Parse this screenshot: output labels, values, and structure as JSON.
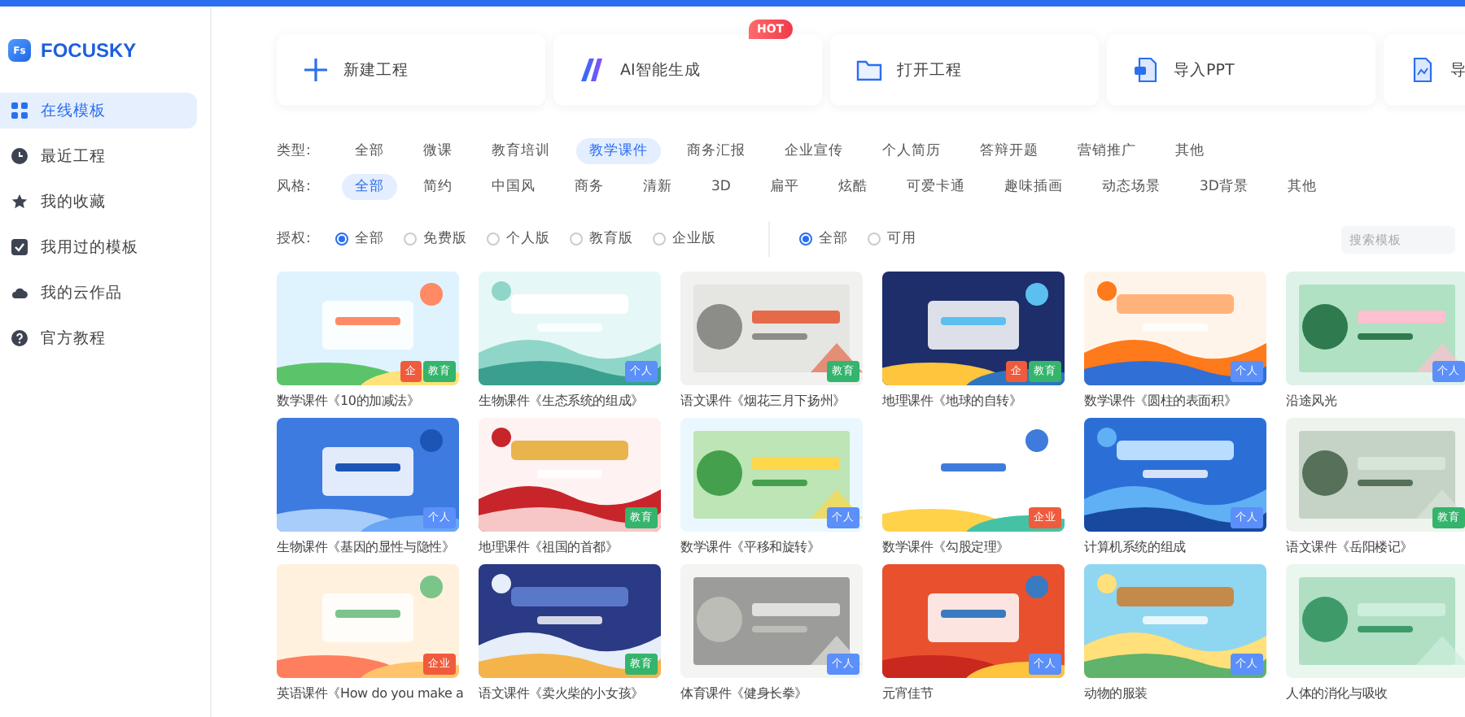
{
  "logo": {
    "badge": "Fs",
    "name": "FOCUSKY"
  },
  "sidebar": {
    "items": [
      {
        "label": "在线模板",
        "selected": true
      },
      {
        "label": "最近工程",
        "selected": false
      },
      {
        "label": "我的收藏",
        "selected": false
      },
      {
        "label": "我用过的模板",
        "selected": false
      },
      {
        "label": "我的云作品",
        "selected": false
      },
      {
        "label": "官方教程",
        "selected": false
      }
    ]
  },
  "actions": [
    {
      "label": "新建工程"
    },
    {
      "label": "AI智能生成",
      "badge": "HOT"
    },
    {
      "label": "打开工程"
    },
    {
      "label": "导入PPT"
    },
    {
      "label": "导"
    }
  ],
  "filters": [
    {
      "label": "类型:",
      "options": [
        {
          "label": "全部",
          "selected": false
        },
        {
          "label": "微课",
          "selected": false
        },
        {
          "label": "教育培训",
          "selected": false
        },
        {
          "label": "教学课件",
          "selected": true
        },
        {
          "label": "商务汇报",
          "selected": false
        },
        {
          "label": "企业宣传",
          "selected": false
        },
        {
          "label": "个人简历",
          "selected": false
        },
        {
          "label": "答辩开题",
          "selected": false
        },
        {
          "label": "营销推广",
          "selected": false
        },
        {
          "label": "其他",
          "selected": false
        }
      ]
    },
    {
      "label": "风格:",
      "options": [
        {
          "label": "全部",
          "selected": true
        },
        {
          "label": "简约",
          "selected": false
        },
        {
          "label": "中国风",
          "selected": false
        },
        {
          "label": "商务",
          "selected": false
        },
        {
          "label": "清新",
          "selected": false
        },
        {
          "label": "3D",
          "selected": false
        },
        {
          "label": "扁平",
          "selected": false
        },
        {
          "label": "炫酷",
          "selected": false
        },
        {
          "label": "可爱卡通",
          "selected": false
        },
        {
          "label": "趣味插画",
          "selected": false
        },
        {
          "label": "动态场景",
          "selected": false
        },
        {
          "label": "3D背景",
          "selected": false
        },
        {
          "label": "其他",
          "selected": false
        }
      ]
    }
  ],
  "license": {
    "label": "授权:",
    "options": [
      {
        "label": "全部",
        "selected": true
      },
      {
        "label": "免费版",
        "selected": false
      },
      {
        "label": "个人版",
        "selected": false
      },
      {
        "label": "教育版",
        "selected": false
      },
      {
        "label": "企业版",
        "selected": false
      }
    ],
    "availability": [
      {
        "label": "全部",
        "selected": true
      },
      {
        "label": "可用",
        "selected": false
      }
    ]
  },
  "search": {
    "placeholder": "搜索模板"
  },
  "templates": [
    {
      "caption": "数学课件《10的加减法》",
      "tags": [
        {
          "kind": "enterprise",
          "label": "企"
        },
        {
          "kind": "education",
          "label": "教育"
        }
      ]
    },
    {
      "caption": "生物课件《生态系统的组成》",
      "tags": [
        {
          "kind": "personal",
          "label": "个人"
        }
      ]
    },
    {
      "caption": "语文课件《烟花三月下扬州》",
      "tags": [
        {
          "kind": "education",
          "label": "教育"
        }
      ]
    },
    {
      "caption": "地理课件《地球的自转》",
      "tags": [
        {
          "kind": "enterprise",
          "label": "企"
        },
        {
          "kind": "education",
          "label": "教育"
        }
      ]
    },
    {
      "caption": "数学课件《圆柱的表面积》",
      "tags": [
        {
          "kind": "personal",
          "label": "个人"
        }
      ]
    },
    {
      "caption": "沿途风光",
      "tags": [
        {
          "kind": "personal",
          "label": "个人"
        }
      ]
    },
    {
      "caption": "生物课件《基因的显性与隐性》",
      "tags": [
        {
          "kind": "personal",
          "label": "个人"
        }
      ]
    },
    {
      "caption": "地理课件《祖国的首都》",
      "tags": [
        {
          "kind": "education",
          "label": "教育"
        }
      ]
    },
    {
      "caption": "数学课件《平移和旋转》",
      "tags": [
        {
          "kind": "personal",
          "label": "个人"
        }
      ]
    },
    {
      "caption": "数学课件《勾股定理》",
      "tags": [
        {
          "kind": "enterprise",
          "label": "企业"
        }
      ]
    },
    {
      "caption": "计算机系统的组成",
      "tags": [
        {
          "kind": "personal",
          "label": "个人"
        }
      ]
    },
    {
      "caption": "语文课件《岳阳楼记》",
      "tags": [
        {
          "kind": "education",
          "label": "教育"
        }
      ]
    },
    {
      "caption": "英语课件《How do you make a",
      "tags": [
        {
          "kind": "enterprise",
          "label": "企业"
        }
      ]
    },
    {
      "caption": "语文课件《卖火柴的小女孩》",
      "tags": [
        {
          "kind": "education",
          "label": "教育"
        }
      ]
    },
    {
      "caption": "体育课件《健身长拳》",
      "tags": [
        {
          "kind": "personal",
          "label": "个人"
        }
      ]
    },
    {
      "caption": "元宵佳节",
      "tags": [
        {
          "kind": "personal",
          "label": "个人"
        }
      ]
    },
    {
      "caption": "动物的服装",
      "tags": [
        {
          "kind": "personal",
          "label": "个人"
        }
      ]
    },
    {
      "caption": "人体的消化与吸收"
    }
  ]
}
